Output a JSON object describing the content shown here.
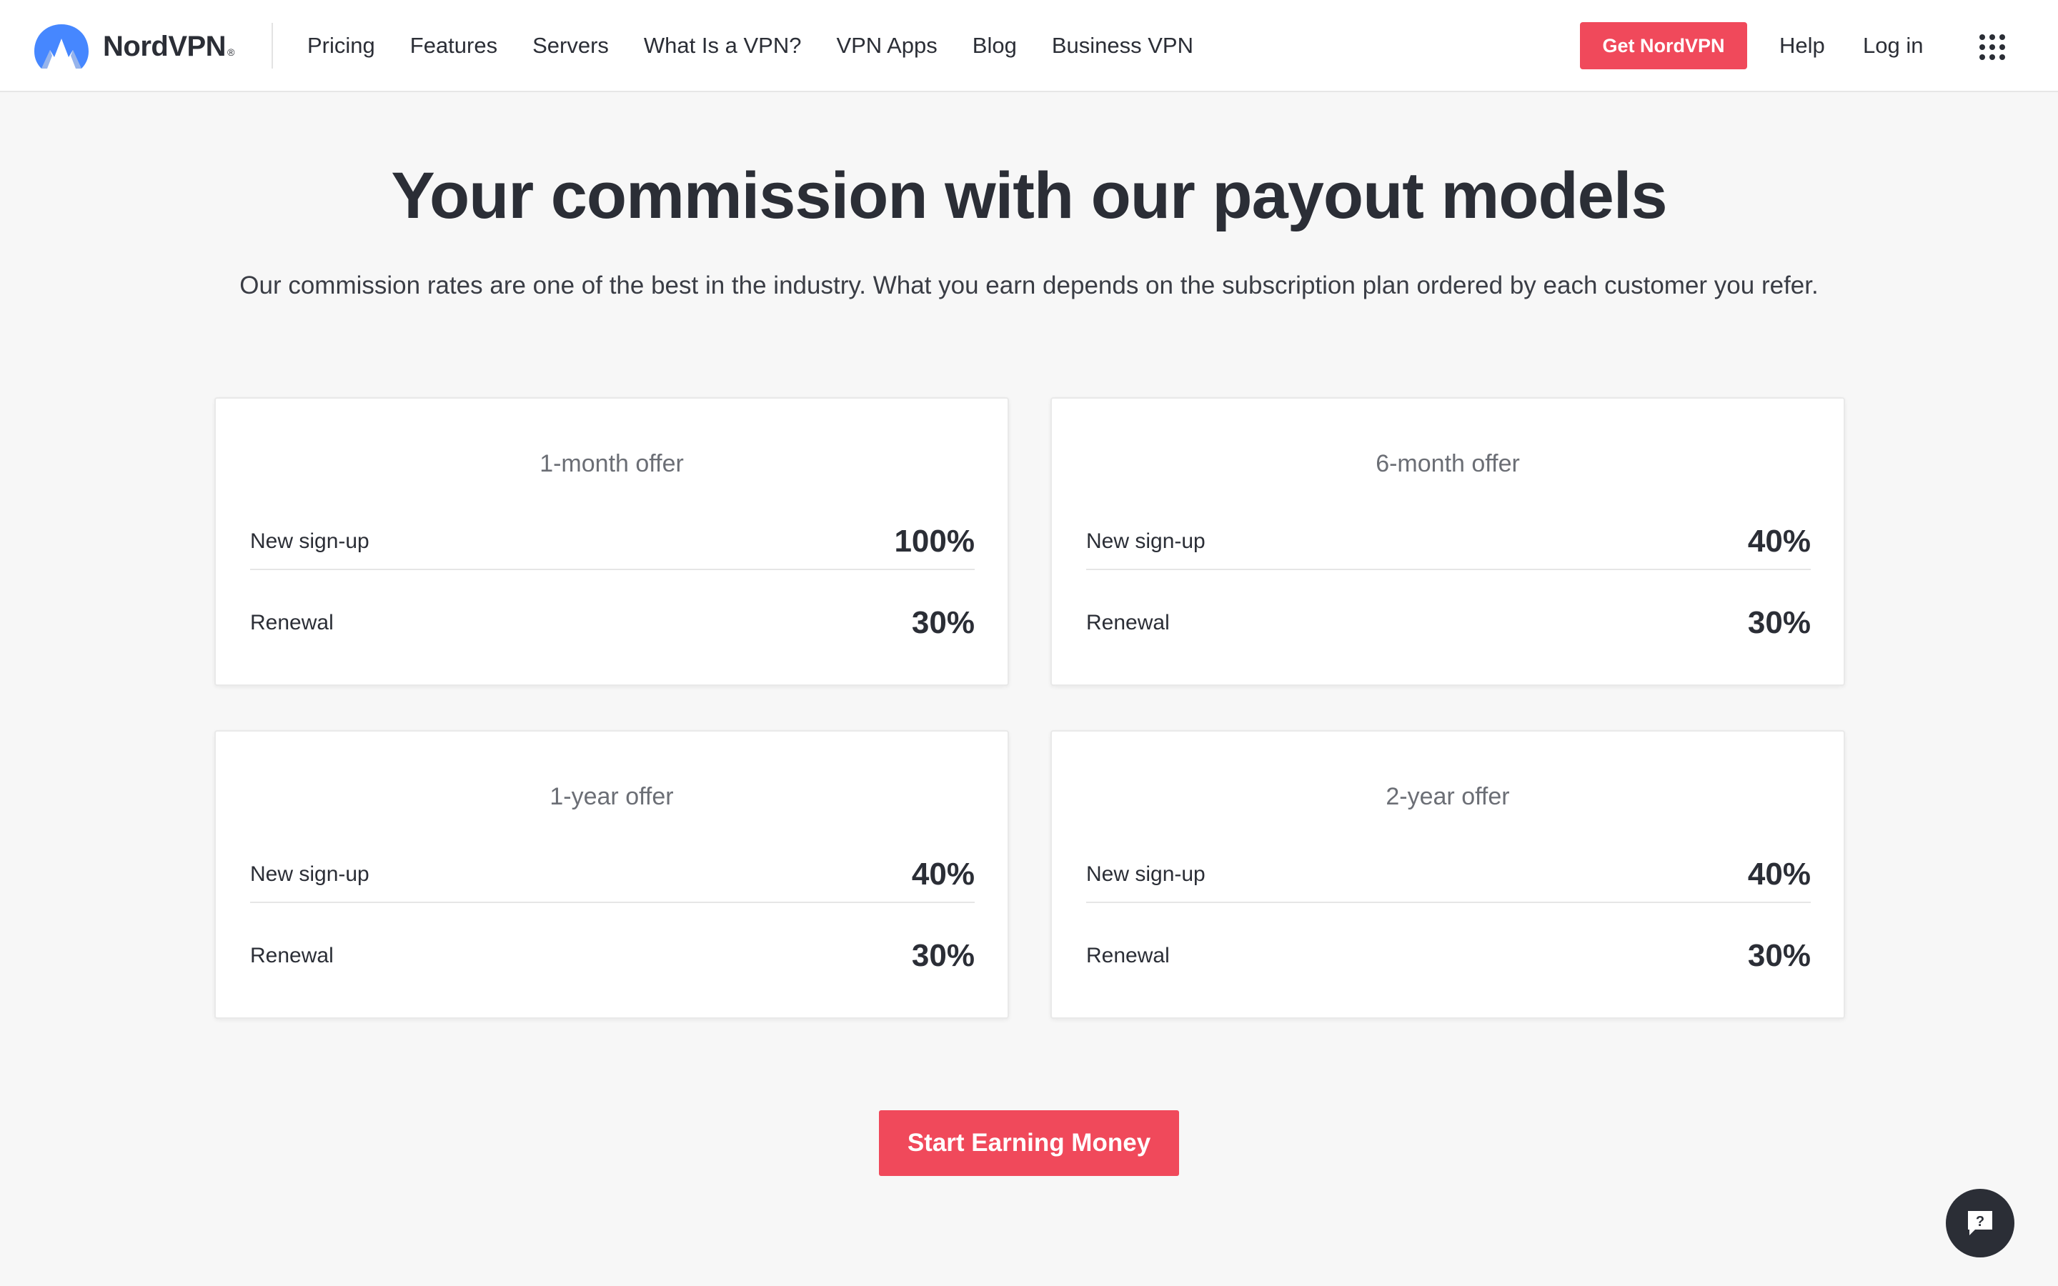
{
  "header": {
    "brand": "NordVPN",
    "brand_mark": "®",
    "nav": [
      "Pricing",
      "Features",
      "Servers",
      "What Is a VPN?",
      "VPN Apps",
      "Blog",
      "Business VPN"
    ],
    "cta_label": "Get NordVPN",
    "help_label": "Help",
    "login_label": "Log in",
    "menu_icon": "grid-menu-icon"
  },
  "main": {
    "title": "Your commission with our payout models",
    "subtitle": "Our commission rates are one of the best in the industry. What you earn depends on the subscription plan ordered by each customer you refer.",
    "offers": [
      {
        "title": "1-month offer",
        "rows": [
          {
            "label": "New sign-up",
            "value": "100%"
          },
          {
            "label": "Renewal",
            "value": "30%"
          }
        ]
      },
      {
        "title": "6-month offer",
        "rows": [
          {
            "label": "New sign-up",
            "value": "40%"
          },
          {
            "label": "Renewal",
            "value": "30%"
          }
        ]
      },
      {
        "title": "1-year offer",
        "rows": [
          {
            "label": "New sign-up",
            "value": "40%"
          },
          {
            "label": "Renewal",
            "value": "30%"
          }
        ]
      },
      {
        "title": "2-year offer",
        "rows": [
          {
            "label": "New sign-up",
            "value": "40%"
          },
          {
            "label": "Renewal",
            "value": "30%"
          }
        ]
      }
    ],
    "cta_label": "Start Earning Money",
    "chat_icon": "help-chat-icon",
    "chat_glyph": "?"
  },
  "colors": {
    "accent": "#f0495b",
    "text": "#2b2e36",
    "logo_blue": "#4687ff",
    "background": "#f7f7f7"
  }
}
